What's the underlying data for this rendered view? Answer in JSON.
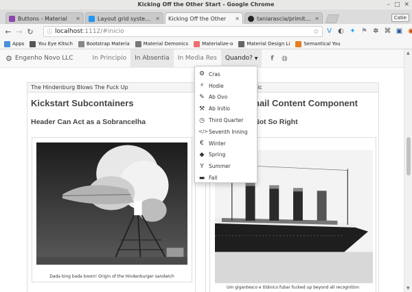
{
  "window": {
    "title": "Kicking Off the Other Start - Google Chrome"
  },
  "tabs": [
    {
      "label": "Buttons - Material",
      "color": "#8e44ad"
    },
    {
      "label": "Layout grid system —",
      "color": "#2196f3"
    },
    {
      "label": "Kicking Off the Other",
      "color": "#cccccc"
    },
    {
      "label": "taniarascia/primitive:",
      "color": "#222222"
    }
  ],
  "profile": "Catie",
  "omnibox": {
    "host": "localhost",
    "path": ":1112/#inicio"
  },
  "bookmarks": [
    {
      "label": "Apps",
      "icon": "apps-icon",
      "color": "#4a90d9"
    },
    {
      "label": "You Eye Kitsch",
      "icon": "bookmark-icon",
      "color": "#555555"
    },
    {
      "label": "Bootstrap Materia",
      "icon": "bookmark-icon",
      "color": "#888888"
    },
    {
      "label": "Material Demonics",
      "icon": "bookmark-icon",
      "color": "#777777"
    },
    {
      "label": "Materialize-o",
      "icon": "materialize-icon",
      "color": "#ee6e73"
    },
    {
      "label": "Material Design Li",
      "icon": "bookmark-icon",
      "color": "#666666"
    },
    {
      "label": "Semantical You",
      "icon": "semantic-icon",
      "color": "#e67e22"
    }
  ],
  "app_nav": {
    "brand": "Engenho Novo LLC",
    "links": [
      "In Principio",
      "In Absentia",
      "In Media Res"
    ],
    "dropdown_label": "Quando?"
  },
  "dropdown_items": [
    {
      "label": "Cras",
      "icon": "⚙"
    },
    {
      "label": "Hodie",
      "icon": "⚡"
    },
    {
      "label": "Ab Ovo",
      "icon": "✎"
    },
    {
      "label": "Ab Initio",
      "icon": "●"
    },
    {
      "label": "Third Quarter",
      "icon": "◷"
    },
    {
      "label": "Seventh Inning",
      "icon": "‹/›"
    },
    {
      "label": "Winter",
      "icon": "€"
    },
    {
      "label": "Spring",
      "icon": "◆"
    },
    {
      "label": "Summer",
      "icon": "Y"
    },
    {
      "label": "Fall",
      "icon": "▬"
    }
  ],
  "left_panel": {
    "heading": "The Hindenburg Blows The Fuck Up",
    "title": "Kickstart Subcontainers",
    "subtitle": "Header Can Act as a Sobrancelha",
    "caption": "Dada bing bada boom! Origin of the Hindenburger sandwich"
  },
  "right_panel": {
    "heading": "nic",
    "title": "nail Content Component",
    "subtitle": "Not So Right",
    "caption": "Um gigantesco e titânico fubar  fucked up beyond all recognition"
  }
}
